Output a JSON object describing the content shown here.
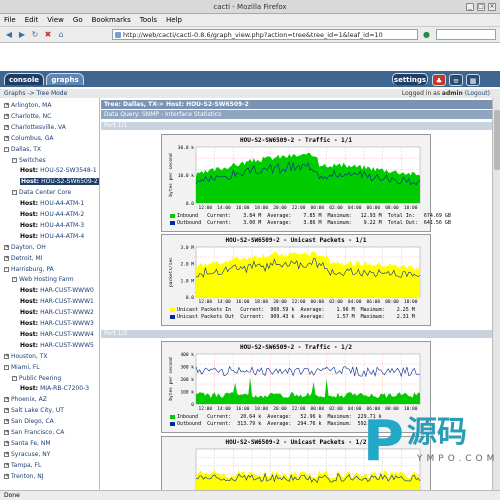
{
  "window": {
    "title": "cacti - Mozilla Firefox"
  },
  "menu": [
    "File",
    "Edit",
    "View",
    "Go",
    "Bookmarks",
    "Tools",
    "Help"
  ],
  "nav": {
    "url": "http://web/cacti/cacti-0.8.6/graph_view.php?action=tree&tree_id=1&leaf_id=10"
  },
  "tabs": {
    "console": "console",
    "graphs": "graphs",
    "settings": "settings"
  },
  "breadcrumb": {
    "path": "Graphs -> Tree Mode",
    "login_prefix": "Logged in as",
    "user": "admin",
    "logout": "(Logout)"
  },
  "tree": [
    {
      "label": "Arlington, MA",
      "indent": 0,
      "box": "+"
    },
    {
      "label": "Charlotte, NC",
      "indent": 0,
      "box": "+"
    },
    {
      "label": "Charlottesville, VA",
      "indent": 0,
      "box": "+"
    },
    {
      "label": "Columbus, GA",
      "indent": 0,
      "box": "+"
    },
    {
      "label": "Dallas, TX",
      "indent": 0,
      "box": "-"
    },
    {
      "label": "Switches",
      "indent": 1,
      "box": "-"
    },
    {
      "label": "HOU-S2-SW3548-1",
      "indent": 2,
      "host": true
    },
    {
      "label": "HOU-S2-SW6509-2",
      "indent": 2,
      "host": true,
      "selected": true
    },
    {
      "label": "Data Center Core",
      "indent": 1,
      "box": "-"
    },
    {
      "label": "HOU-A4-ATM-1",
      "indent": 2,
      "host": true
    },
    {
      "label": "HOU-A4-ATM-2",
      "indent": 2,
      "host": true
    },
    {
      "label": "HOU-A4-ATM-3",
      "indent": 2,
      "host": true
    },
    {
      "label": "HOU-A4-ATM-4",
      "indent": 2,
      "host": true
    },
    {
      "label": "Dayton, OH",
      "indent": 0,
      "box": "+"
    },
    {
      "label": "Detroit, MI",
      "indent": 0,
      "box": "+"
    },
    {
      "label": "Harrisburg, PA",
      "indent": 0,
      "box": "-"
    },
    {
      "label": "Web Hosting Farm",
      "indent": 1,
      "box": "-"
    },
    {
      "label": "HAR-CUST-WWW0",
      "indent": 2,
      "host": true
    },
    {
      "label": "HAR-CUST-WWW1",
      "indent": 2,
      "host": true
    },
    {
      "label": "HAR-CUST-WWW2",
      "indent": 2,
      "host": true
    },
    {
      "label": "HAR-CUST-WWW3",
      "indent": 2,
      "host": true
    },
    {
      "label": "HAR-CUST-WWW4",
      "indent": 2,
      "host": true
    },
    {
      "label": "HAR-CUST-WWW5",
      "indent": 2,
      "host": true
    },
    {
      "label": "Houston, TX",
      "indent": 0,
      "box": "+"
    },
    {
      "label": "Miami, FL",
      "indent": 0,
      "box": "-"
    },
    {
      "label": "Public Peering",
      "indent": 1,
      "box": "-"
    },
    {
      "label": "MIA-RB-C7200-3",
      "indent": 2,
      "host": true
    },
    {
      "label": "Phoenix, AZ",
      "indent": 0,
      "box": "+"
    },
    {
      "label": "Salt Lake City, UT",
      "indent": 0,
      "box": "+"
    },
    {
      "label": "San Diego, CA",
      "indent": 0,
      "box": "+"
    },
    {
      "label": "San Francisco, CA",
      "indent": 0,
      "box": "+"
    },
    {
      "label": "Santa Fe, NM",
      "indent": 0,
      "box": "+"
    },
    {
      "label": "Syracuse, NY",
      "indent": 0,
      "box": "+"
    },
    {
      "label": "Tampa, FL",
      "indent": 0,
      "box": "+"
    },
    {
      "label": "Trenton, NJ",
      "indent": 0,
      "box": "+"
    }
  ],
  "host_prefix": "Host:",
  "main": {
    "header": "Tree: Dallas, TX-> Host: HOU-S2-SW6509-2",
    "query": "Data Query: SNMP - Interface Statistics",
    "port1": "Port 1/1",
    "port2": "Port 1/2"
  },
  "graphs": [
    {
      "title": "HOU-S2-SW6509-2 - Traffic - 1/1",
      "ylabel": "bytes per second",
      "yticks": [
        "30.0 k",
        "10.0 k",
        "0.0"
      ],
      "xticks": [
        "12:00",
        "14:00",
        "16:00",
        "18:00",
        "20:00",
        "22:00",
        "00:00",
        "02:00",
        "04:00",
        "06:00",
        "08:00",
        "10:00"
      ],
      "legend": [
        "Inbound   Current:    3.84 M  Average:    7.85 M  Maximum:   12.93 M  Total In:   674.69 GB",
        "Outbound  Current:    3.00 M  Average:    3.86 M  Maximum:    9.22 M  Total Out:  641.56 GB"
      ],
      "colors": [
        "#00cc00",
        "#002a97"
      ]
    },
    {
      "title": "HOU-S2-SW6509-2 - Unicast Packets - 1/1",
      "ylabel": "packets/sec",
      "yticks": [
        "3.0 M",
        "2.0 M",
        "1.0 M",
        "0.0"
      ],
      "xticks": [
        "12:00",
        "14:00",
        "16:00",
        "18:00",
        "20:00",
        "22:00",
        "00:00",
        "02:00",
        "04:00",
        "06:00",
        "08:00",
        "10:00"
      ],
      "legend": [
        "Unicast Packets In   Current:  960.59 k  Average:    1.96 M  Maximum:    2.25 M",
        "Unicast Packets Out  Current:  909.43 k  Average:    1.57 M  Maximum:    2.31 M"
      ],
      "colors": [
        "#ffff00",
        "#002a97"
      ]
    },
    {
      "title": "HOU-S2-SW6509-2 - Traffic - 1/2",
      "ylabel": "bytes per second",
      "yticks": [
        "400 k",
        "300 k",
        "200 k",
        "100 k",
        "0"
      ],
      "xticks": [
        "12:00",
        "14:00",
        "16:00",
        "18:00",
        "20:00",
        "22:00",
        "00:00",
        "02:00",
        "04:00",
        "06:00",
        "08:00",
        "10:00"
      ],
      "legend": [
        "Inbound   Current:   20.64 k  Average:   52.96 k  Maximum:  229.71 k",
        "Outbound  Current:  313.79 k  Average:  294.76 k  Maximum:  592.97 k"
      ],
      "colors": [
        "#00cc00",
        "#002a97"
      ]
    },
    {
      "title": "HOU-S2-SW6509-2 - Unicast Packets - 1/2",
      "ylabel": "",
      "yticks": [],
      "xticks": [],
      "legend": [],
      "colors": [
        "#ffff00",
        "#002a97"
      ]
    }
  ],
  "statusbar": "Done",
  "watermark": {
    "text": "源码",
    "sub": "YMPO.COM"
  }
}
